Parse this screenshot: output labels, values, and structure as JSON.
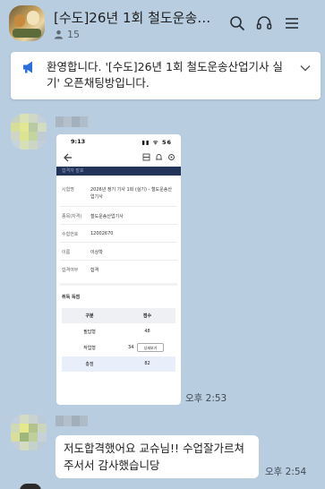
{
  "header": {
    "room_title": "[수도]26년 1회 철도운송산업기사 실기",
    "member_count": "15",
    "icons": [
      "search-icon",
      "headset-icon",
      "menu-icon"
    ]
  },
  "notice": {
    "text": "환영합니다. '[수도]26년 1회 철도운송산업기사 실기' 오픈채팅방입니다.",
    "icon": "megaphone-icon",
    "chevron": "chevron-down-icon"
  },
  "messages": [
    {
      "type": "image",
      "time": "오후 2:53",
      "image": {
        "status_time": "9:13",
        "status_signal": "▮▮ ᯤ 56",
        "banner": "합격자 발표",
        "fields": [
          {
            "label": "시험명",
            "value": "2026년 정기 기사 1회 (실기) - 철도운송산업기사"
          },
          {
            "label": "종목(자격)",
            "value": "철도운송산업기사"
          },
          {
            "label": "수험번호",
            "value": "12002670"
          },
          {
            "label": "이름",
            "value": "이상학"
          },
          {
            "label": "합격여부",
            "value": "합격"
          }
        ],
        "section_title": "취득 득점",
        "table_headers": [
          "구분",
          "점수"
        ],
        "table_rows": [
          {
            "name": "필답형",
            "score": "48"
          },
          {
            "name": "작업형",
            "score": "34",
            "button": "상세보기"
          },
          {
            "name": "총점",
            "score": "82"
          }
        ]
      }
    },
    {
      "type": "text",
      "time": "오후 2:54",
      "text": "저도합격했어요 교슈님!! 수업잘가르쳐주서서 감사했습니당"
    }
  ],
  "colors": {
    "background": "#b8cde0",
    "bubble": "#ffffff",
    "notice_accent": "#2a6fdb",
    "phone_banner": "#22345a"
  }
}
